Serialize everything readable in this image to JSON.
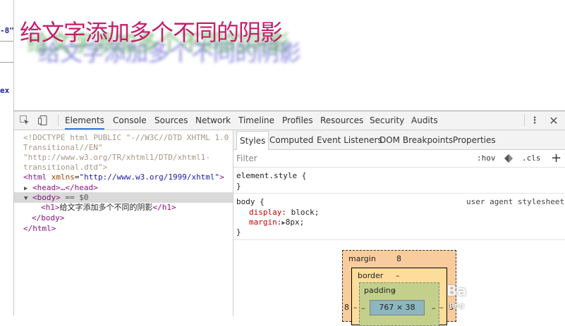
{
  "left_strip": {
    "line1": "-8\"",
    "line2": "ex"
  },
  "page": {
    "heading": "给文字添加多个不同的阴影"
  },
  "devtools": {
    "tabs": [
      "Elements",
      "Console",
      "Sources",
      "Network",
      "Timeline",
      "Profiles",
      "Resources",
      "Security",
      "Audits"
    ],
    "active_tab": "Elements",
    "elements": {
      "doctype_line1": "<!DOCTYPE html PUBLIC \"-//W3C//DTD XHTML 1.0",
      "doctype_line2": "Transitional//EN\"",
      "doctype_line3": "\"http://www.w3.org/TR/xhtml1/DTD/xhtml1-",
      "doctype_line4": "transitional.dtd\">",
      "html_open_tag": "<html",
      "html_attr_name": "xmlns",
      "html_attr_value": "\"http://www.w3.org/1999/xhtml\"",
      "html_open_close": ">",
      "head_line": "<head>…</head>",
      "body_open": "<body>",
      "body_eq": "== $0",
      "h1_open": "<h1>",
      "h1_text": "给文字添加多个不同的阴影",
      "h1_close": "</h1>",
      "body_close": "</body>",
      "html_close": "</html>"
    },
    "side_tabs": [
      "Styles",
      "Computed",
      "Event Listeners",
      "DOM Breakpoints",
      "Properties"
    ],
    "active_side_tab": "Styles",
    "filter_placeholder": "Filter",
    "hov": ":hov",
    "cls": ".cls",
    "add": "+",
    "element_style": "element.style {",
    "close_brace": "}",
    "body_selector": "body {",
    "user_agent": "user agent stylesheet",
    "display_prop": "display",
    "display_val": "block;",
    "margin_prop": "margin",
    "margin_val": "8px;",
    "box_model": {
      "margin_label": "margin",
      "margin_value": "8",
      "margin_left": "8",
      "margin_right": "8",
      "border_label": "border",
      "border_value": "–",
      "border_left": "–",
      "border_right": "–",
      "padding_label": "padding",
      "padding_value": "–",
      "padding_left": "–",
      "padding_right": "–",
      "content_size": "767 × 38"
    },
    "watermark": "Ba",
    "watermark_sub": "jing"
  }
}
